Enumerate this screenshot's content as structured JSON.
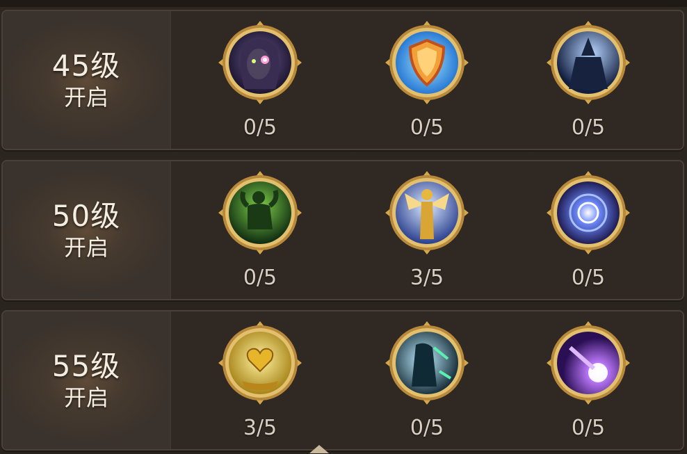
{
  "rows": [
    {
      "level": "45级",
      "unlock_label": "开启",
      "skills": [
        {
          "icon": "shadow-woman-icon",
          "points": "0/5"
        },
        {
          "icon": "shield-icon",
          "points": "0/5"
        },
        {
          "icon": "wizard-icon",
          "points": "0/5"
        }
      ]
    },
    {
      "level": "50级",
      "unlock_label": "开启",
      "skills": [
        {
          "icon": "strength-man-icon",
          "points": "0/5"
        },
        {
          "icon": "golden-angel-icon",
          "points": "3/5"
        },
        {
          "icon": "energy-vortex-icon",
          "points": "0/5"
        }
      ]
    },
    {
      "level": "55级",
      "unlock_label": "开启",
      "skills": [
        {
          "icon": "healing-heart-icon",
          "points": "3/5"
        },
        {
          "icon": "nature-shaman-icon",
          "points": "0/5"
        },
        {
          "icon": "arcane-orb-icon",
          "points": "0/5"
        }
      ]
    }
  ],
  "colors": {
    "background": "#2b2520",
    "frame_gold": "#e2c06e",
    "text": "#f4ede2",
    "count_text": "#d9cfc2"
  }
}
